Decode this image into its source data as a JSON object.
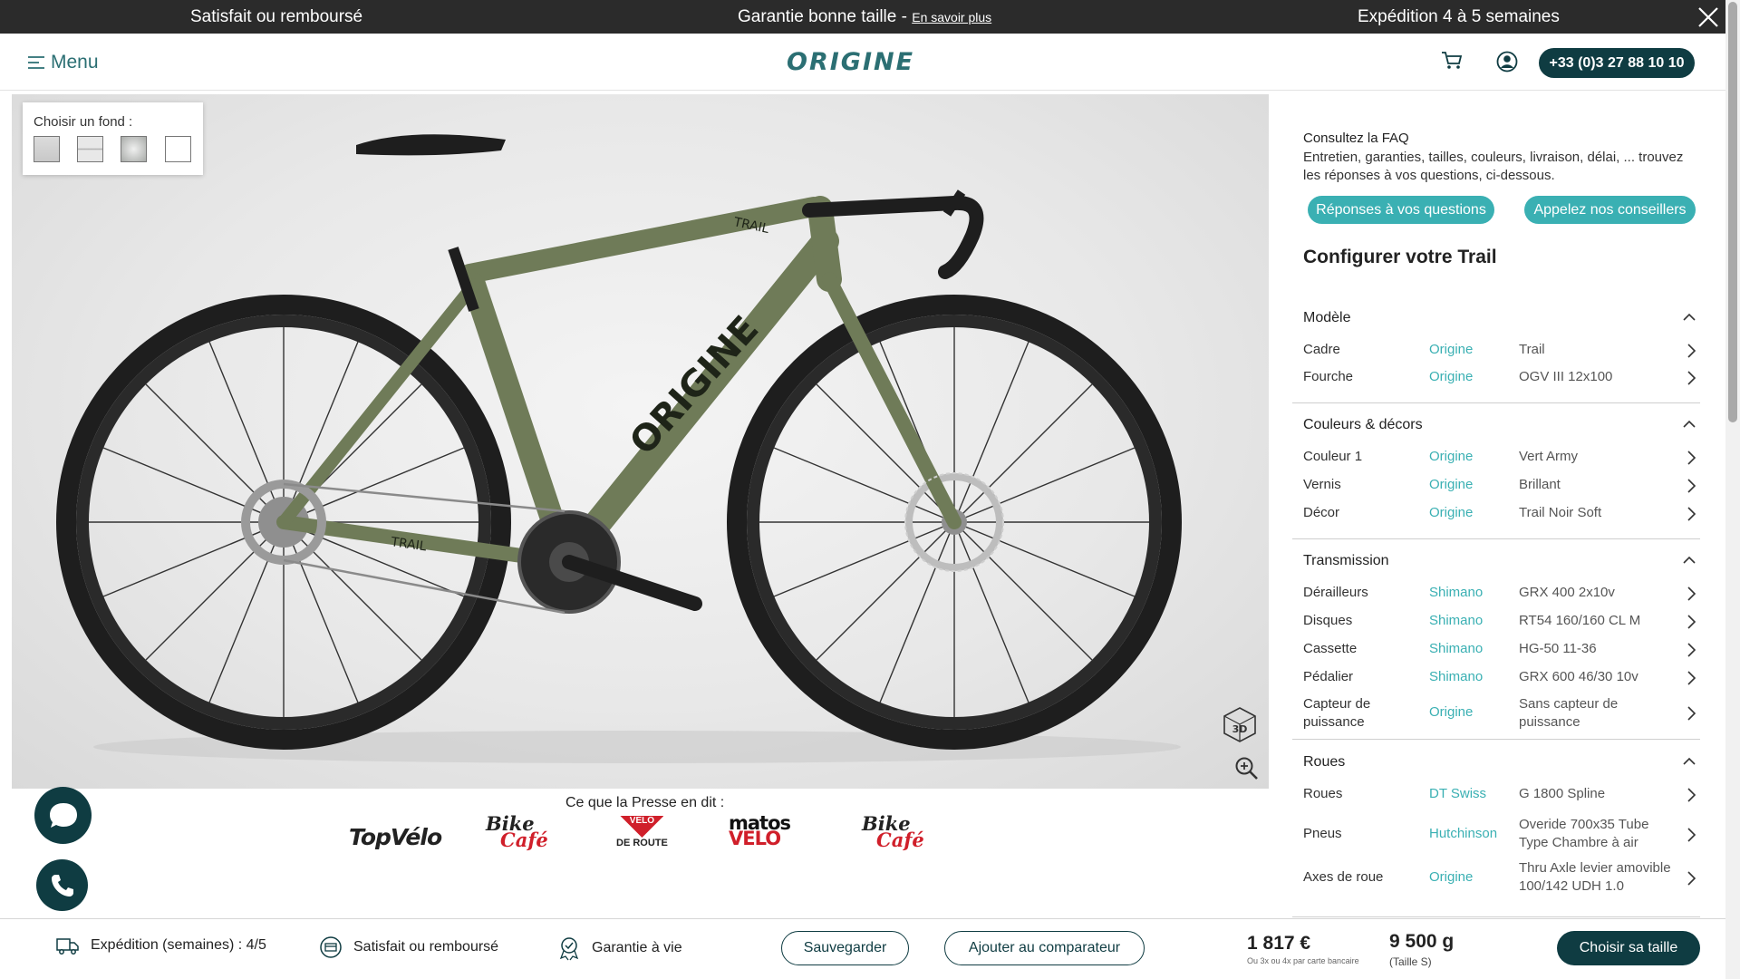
{
  "topbar": {
    "msg1": "Satisfait ou remboursé",
    "msg2": "Garantie bonne taille - ",
    "msg2_link": "En savoir plus",
    "msg3": "Expédition 4 à 5 semaines",
    "close_icon": "close-icon"
  },
  "header": {
    "menu_label": "Menu",
    "logo_text": "ORIGINE",
    "phone": "+33 (0)3 27 88 10 10",
    "cart_icon": "cart-icon",
    "account_icon": "account-icon"
  },
  "viewer": {
    "bg_label": "Choisir un fond :",
    "frame_text": "ORIGINE",
    "tube_text": "TRAIL",
    "view3d_label": "3D",
    "colors": {
      "frame": "#6f7b58",
      "tire": "#1e1e1e",
      "rim": "#2a2a2a"
    }
  },
  "press": {
    "title": "Ce que la Presse en dit :",
    "logos": [
      {
        "name": "TopVélo"
      },
      {
        "l1": "Bike",
        "l2": "Café"
      },
      {
        "l1": "VELO",
        "l2": "DE ROUTE"
      },
      {
        "l1": "matos",
        "l2": "VELO"
      },
      {
        "l1": "Bike",
        "l2": "Café"
      }
    ]
  },
  "panel": {
    "faq_title": "Consultez la FAQ",
    "faq_text": "Entretien, garanties, tailles, couleurs, livraison, délai, ... trouvez les réponses à vos questions, ci-dessous.",
    "faq_button": "Réponses à vos questions",
    "call_button": "Appelez nos conseillers",
    "config_title": "Configurer votre Trail",
    "sections": [
      {
        "title": "Modèle",
        "rows": [
          {
            "k": "Cadre",
            "b": "Origine",
            "v": "Trail"
          },
          {
            "k": "Fourche",
            "b": "Origine",
            "v": "OGV III 12x100"
          }
        ]
      },
      {
        "title": "Couleurs & décors",
        "rows": [
          {
            "k": "Couleur 1",
            "b": "Origine",
            "v": "Vert Army"
          },
          {
            "k": "Vernis",
            "b": "Origine",
            "v": "Brillant"
          },
          {
            "k": "Décor",
            "b": "Origine",
            "v": "Trail Noir Soft"
          }
        ]
      },
      {
        "title": "Transmission",
        "rows": [
          {
            "k": "Dérailleurs",
            "b": "Shimano",
            "v": "GRX 400 2x10v"
          },
          {
            "k": "Disques",
            "b": "Shimano",
            "v": "RT54 160/160 CL M"
          },
          {
            "k": "Cassette",
            "b": "Shimano",
            "v": "HG-50 11-36"
          },
          {
            "k": "Pédalier",
            "b": "Shimano",
            "v": "GRX 600 46/30 10v"
          },
          {
            "k": "Capteur de puissance",
            "b": "Origine",
            "v": "Sans capteur de puissance"
          }
        ]
      },
      {
        "title": "Roues",
        "rows": [
          {
            "k": "Roues",
            "b": "DT Swiss",
            "v": "G 1800 Spline"
          },
          {
            "k": "Pneus",
            "b": "Hutchinson",
            "v": "Overide 700x35 Tube Type Chambre à air"
          },
          {
            "k": "Axes de roue",
            "b": "Origine",
            "v": "Thru Axle levier amovible 100/142 UDH 1.0"
          }
        ]
      }
    ]
  },
  "bottombar": {
    "shipping": "Expédition (semaines) : 4/5",
    "refund": "Satisfait ou remboursé",
    "warranty": "Garantie à vie",
    "save": "Sauvegarder",
    "compare": "Ajouter au comparateur",
    "price": "1 817 €",
    "price_sub": "Ou 3x ou 4x par carte bancaire",
    "weight": "9 500 g",
    "weight_sub": "(Taille S)",
    "cta": "Choisir sa taille"
  }
}
